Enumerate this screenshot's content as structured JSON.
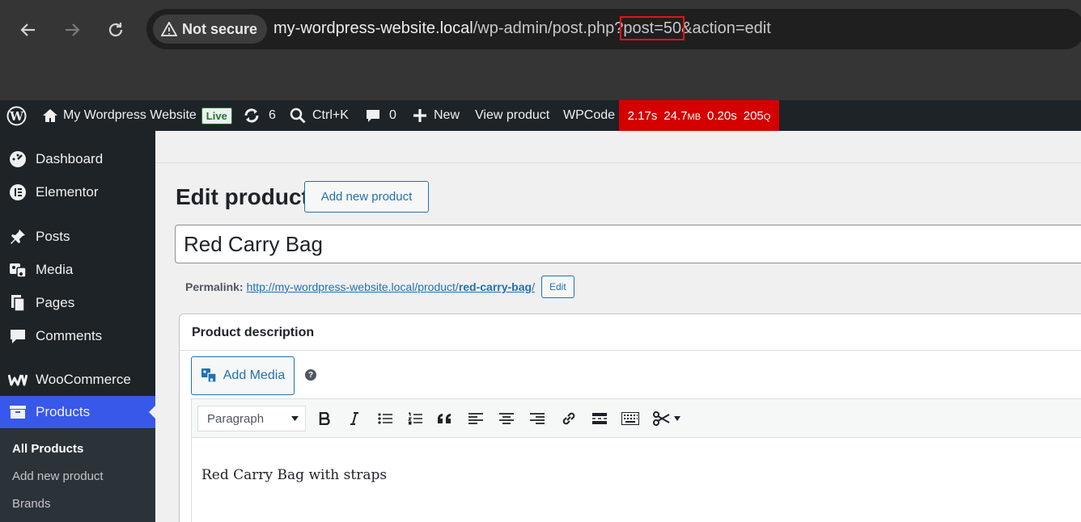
{
  "browser": {
    "security_label": "Not secure",
    "url_host": "my-wordpress-website.local",
    "url_path": "/wp-admin/post.php?",
    "url_highlight": "post=50",
    "url_rest": "&action=edit"
  },
  "adminbar": {
    "site_name": "My Wordpress Website",
    "live_label": "Live",
    "updates_count": "6",
    "search_shortcut": "Ctrl+K",
    "comments_count": "0",
    "new_label": "New",
    "view_product_label": "View product",
    "wpcode_label": "WPCode",
    "perf_time": "2.17s",
    "perf_memory": "24.7",
    "perf_memory_unit": "MB",
    "perf_query_time": "0.20s",
    "perf_queries": "205",
    "perf_queries_unit": "Q"
  },
  "sidebar": {
    "items": [
      {
        "label": "Dashboard"
      },
      {
        "label": "Elementor"
      },
      {
        "label": "Posts"
      },
      {
        "label": "Media"
      },
      {
        "label": "Pages"
      },
      {
        "label": "Comments"
      },
      {
        "label": "WooCommerce"
      },
      {
        "label": "Products"
      }
    ],
    "submenu": [
      {
        "label": "All Products"
      },
      {
        "label": "Add new product"
      },
      {
        "label": "Brands"
      }
    ]
  },
  "main": {
    "page_title": "Edit product",
    "add_new_label": "Add new product",
    "product_title": "Red Carry Bag",
    "permalink_label": "Permalink:",
    "permalink_base": "http://my-wordpress-website.local/product/",
    "permalink_slug": "red-carry-bag",
    "permalink_trailing": "/",
    "permalink_edit_label": "Edit",
    "description_title": "Product description",
    "add_media_label": "Add Media",
    "help_glyph": "?",
    "format_select_value": "Paragraph",
    "editor_text": "Red Carry Bag with straps"
  },
  "colors": {
    "admin_bar_bg": "#1d2327",
    "active_menu": "#3858e9",
    "perf_bg": "#d50000",
    "link": "#2271b1",
    "url_highlight_box": "#e0141e"
  }
}
